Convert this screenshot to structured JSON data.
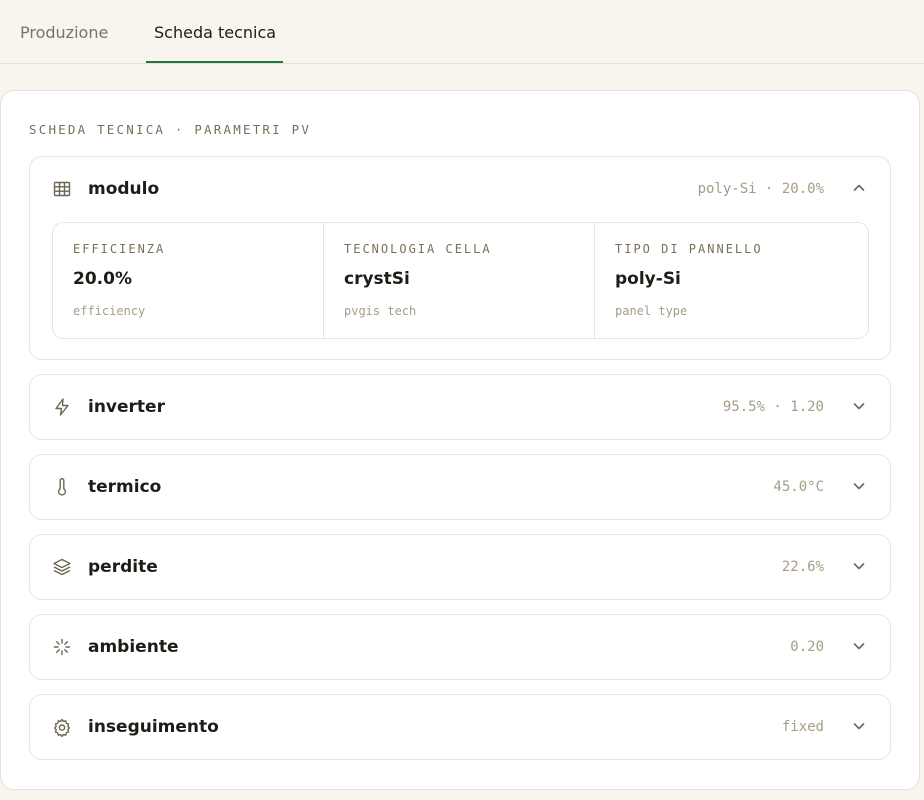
{
  "tabs": [
    {
      "label": "Produzione",
      "active": false
    },
    {
      "label": "Scheda tecnica",
      "active": true
    }
  ],
  "section_title": "SCHEDA TECNICA · PARAMETRI PV",
  "colors": {
    "accent": "#1e7a3c",
    "muted": "#a69c87",
    "label": "#7a7059"
  },
  "cards": [
    {
      "title": "modulo",
      "summary": "poly-Si · 20.0%",
      "icon": "grid-icon",
      "expanded": true,
      "details": [
        {
          "label": "EFFICIENZA",
          "value": "20.0%",
          "sub": "efficiency"
        },
        {
          "label": "TECNOLOGIA CELLA",
          "value": "crystSi",
          "sub": "pvgis tech"
        },
        {
          "label": "TIPO DI PANNELLO",
          "value": "poly-Si",
          "sub": "panel type"
        }
      ]
    },
    {
      "title": "inverter",
      "summary": "95.5% · 1.20",
      "icon": "lightning-icon",
      "expanded": false
    },
    {
      "title": "termico",
      "summary": "45.0°C",
      "icon": "thermometer-icon",
      "expanded": false
    },
    {
      "title": "perdite",
      "summary": "22.6%",
      "icon": "layers-icon",
      "expanded": false
    },
    {
      "title": "ambiente",
      "summary": "0.20",
      "icon": "sparkle-loader-icon",
      "expanded": false
    },
    {
      "title": "inseguimento",
      "summary": "fixed",
      "icon": "gear-icon",
      "expanded": false
    }
  ]
}
